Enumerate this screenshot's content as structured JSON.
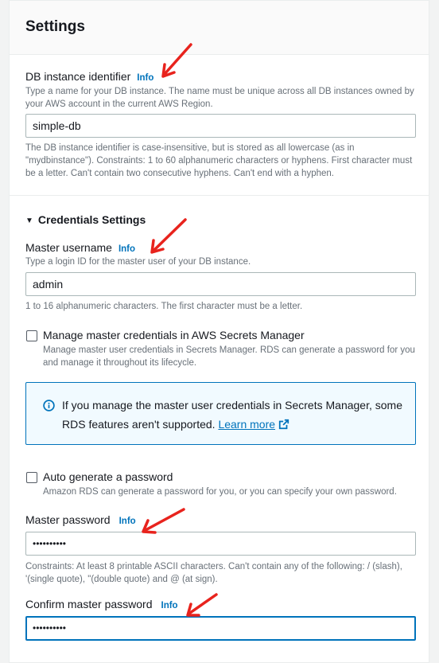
{
  "settings": {
    "title": "Settings",
    "db_identifier": {
      "label": "DB instance identifier",
      "info": "Info",
      "description": "Type a name for your DB instance. The name must be unique across all DB instances owned by your AWS account in the current AWS Region.",
      "value": "simple-db",
      "constraints": "The DB instance identifier is case-insensitive, but is stored as all lowercase (as in \"mydbinstance\"). Constraints: 1 to 60 alphanumeric characters or hyphens. First character must be a letter. Can't contain two consecutive hyphens. Can't end with a hyphen."
    },
    "credentials": {
      "heading": "Credentials Settings",
      "master_username": {
        "label": "Master username",
        "info": "Info",
        "description": "Type a login ID for the master user of your DB instance.",
        "value": "admin",
        "constraints": "1 to 16 alphanumeric characters. The first character must be a letter."
      },
      "manage_secrets": {
        "label": "Manage master credentials in AWS Secrets Manager",
        "description": "Manage master user credentials in Secrets Manager. RDS can generate a password for you and manage it throughout its lifecycle.",
        "checked": false
      },
      "alert": {
        "text": "If you manage the master user credentials in Secrets Manager, some RDS features aren't supported.",
        "link": "Learn more"
      },
      "auto_generate": {
        "label": "Auto generate a password",
        "description": "Amazon RDS can generate a password for you, or you can specify your own password.",
        "checked": false
      },
      "master_password": {
        "label": "Master password",
        "info": "Info",
        "value": "••••••••••",
        "constraints": "Constraints: At least 8 printable ASCII characters. Can't contain any of the following: / (slash), '(single quote), \"(double quote) and @ (at sign)."
      },
      "confirm_password": {
        "label": "Confirm master password",
        "info": "Info",
        "value": "••••••••••"
      }
    }
  },
  "colors": {
    "link": "#0073bb",
    "annotation_arrow": "#e8231d",
    "alert_background": "#f1faff"
  }
}
